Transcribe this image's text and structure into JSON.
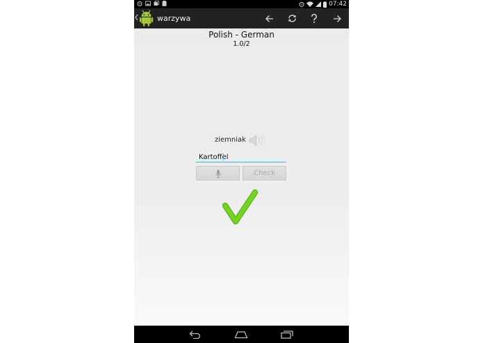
{
  "status_bar": {
    "time": "07:42",
    "left_icons": [
      "alarm-icon",
      "image-icon",
      "photos-icon",
      "clipboard-icon"
    ],
    "right_icons": [
      "alarm-icon",
      "wifi-icon",
      "signal-icon",
      "battery-icon"
    ]
  },
  "action_bar": {
    "title": "warzywa",
    "icons": [
      "back-arrow-icon",
      "refresh-icon",
      "help-icon",
      "forward-arrow-icon"
    ]
  },
  "quiz": {
    "language_pair": "Polish - German",
    "progress": "1.0/2",
    "question_word": "ziemniak",
    "answer_value": "Kartoffel",
    "check_label": "Check",
    "result": "correct"
  },
  "colors": {
    "action_bar_bg": "#222222",
    "accent": "#33b5e5",
    "check_green": "#6ccf1e",
    "android_green": "#a4c639"
  },
  "nav_bar": {
    "icons": [
      "nav-back-icon",
      "nav-home-icon",
      "nav-recents-icon"
    ]
  }
}
